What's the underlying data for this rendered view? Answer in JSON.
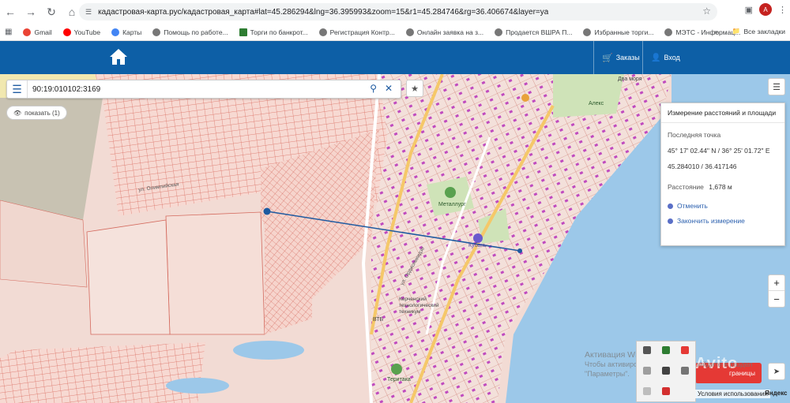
{
  "browser": {
    "url": "кадастровая-карта.рус/кадастровая_карта#lat=45.286294&lng=36.395993&zoom=15&r1=45.284746&rg=36.406674&layer=ya",
    "profile_initial": "А",
    "bookmarks": [
      "Gmail",
      "YouTube",
      "Карты",
      "Помощь по работе...",
      "Торги по банкрот...",
      "Регистрация Контр...",
      "Онлайн заявка на з...",
      "Продается ВШРА П...",
      "Избранные торги...",
      "МЭТС - Информац..."
    ],
    "all_bookmarks": "Все закладки",
    "overflow": "»"
  },
  "header": {
    "orders": "Заказы",
    "login": "Вход"
  },
  "search": {
    "value": "90:19:010102:3169"
  },
  "show_pill": "показать (1)",
  "measure": {
    "title": "Измерение расстояний и площади",
    "last_point_label": "Последняя точка",
    "coords_dms": "45° 17' 02.44\" N / 36° 25' 01.72\" E",
    "coords_dec": "45.284010 / 36.417146",
    "distance_label": "Расстояние",
    "distance_value": "1,678 м",
    "cancel": "Отменить",
    "finish": "Закончить измерение"
  },
  "map": {
    "labels": [
      "Металлург",
      "Керченский технологический техникум",
      "Теритака",
      "Два моря",
      "Алекс",
      "Кубань",
      "ВТБ",
      "ул. Олимпийская",
      "ул. Орджоникидзе"
    ],
    "attribution_terms": "Условия использования",
    "attribution_brand": "Яндекс",
    "zoom_in": "+",
    "zoom_out": "−",
    "red_button": "границы",
    "watermark": "Avito"
  },
  "os_watermark": {
    "line1": "Активация Windows",
    "line2": "Чтобы активировать Windows, перейдите в раздел",
    "line3": "\"Параметры\"."
  }
}
